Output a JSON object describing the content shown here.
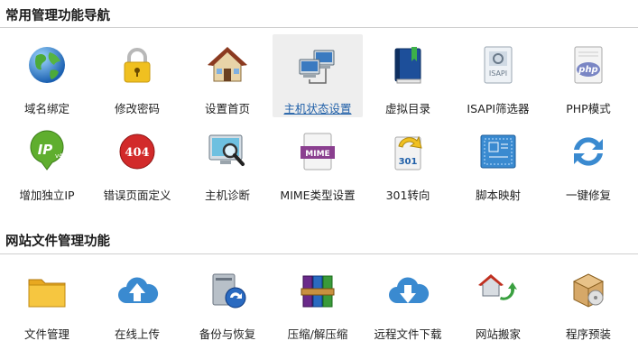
{
  "sections": [
    {
      "title": "常用管理功能导航"
    },
    {
      "title": "网站文件管理功能"
    }
  ],
  "tiles": [
    {
      "label": "域名绑定",
      "icon": "globe-icon"
    },
    {
      "label": "修改密码",
      "icon": "padlock-icon"
    },
    {
      "label": "设置首页",
      "icon": "house-icon"
    },
    {
      "label": "主机状态设置",
      "icon": "network-computers-icon",
      "active": true
    },
    {
      "label": "虚拟目录",
      "icon": "book-icon"
    },
    {
      "label": "ISAPI筛选器",
      "icon": "isapi-file-icon",
      "icon_text": "ISAPI"
    },
    {
      "label": "PHP模式",
      "icon": "php-file-icon",
      "icon_text": "php"
    },
    {
      "label": "增加独立IP",
      "icon": "ipv4-pin-icon",
      "icon_text": "IP",
      "icon_subtext": "v4"
    },
    {
      "label": "错误页面定义",
      "icon": "error-404-icon",
      "icon_text": "404"
    },
    {
      "label": "主机诊断",
      "icon": "monitor-magnifier-icon"
    },
    {
      "label": "MIME类型设置",
      "icon": "mime-icon",
      "icon_text": "MIME"
    },
    {
      "label": "301转向",
      "icon": "redirect-301-icon",
      "icon_text": "301"
    },
    {
      "label": "脚本映射",
      "icon": "script-blueprint-icon"
    },
    {
      "label": "一键修复",
      "icon": "refresh-arrows-icon"
    },
    {
      "label": "文件管理",
      "icon": "folder-icon"
    },
    {
      "label": "在线上传",
      "icon": "cloud-upload-icon"
    },
    {
      "label": "备份与恢复",
      "icon": "backup-drive-icon"
    },
    {
      "label": "压缩/解压缩",
      "icon": "archive-icon"
    },
    {
      "label": "远程文件下载",
      "icon": "cloud-download-icon"
    },
    {
      "label": "网站搬家",
      "icon": "move-house-icon"
    },
    {
      "label": "程序预装",
      "icon": "install-package-icon"
    }
  ],
  "colors": {
    "active_bg": "#eeeeee",
    "active_link": "#1f5fa8",
    "rule": "#cfcfcf"
  }
}
